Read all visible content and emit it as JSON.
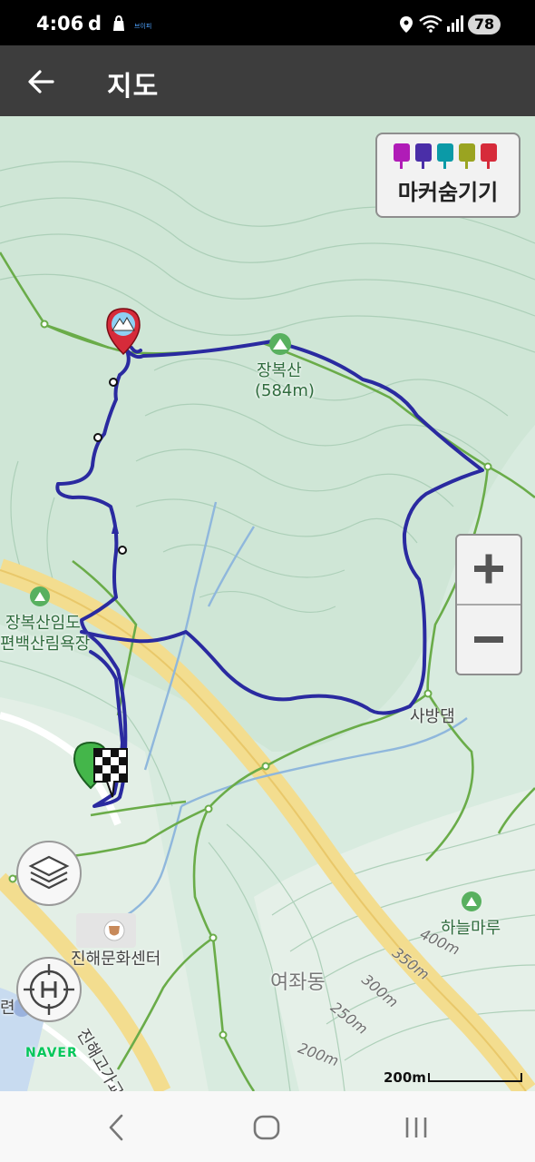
{
  "status": {
    "time": "4:06",
    "app_glyph": "d",
    "mini_text": "브이피",
    "battery": "78",
    "icons": [
      "shopping-bag-icon",
      "location-icon",
      "wifi-icon",
      "signal-icon"
    ]
  },
  "app_bar": {
    "title": "지도",
    "back_icon": "back-arrow-icon"
  },
  "map": {
    "marker_toggle_label": "마커숨기기",
    "marker_colors": [
      "#b01cb7",
      "#4a2ea8",
      "#0b9aa7",
      "#9aa421",
      "#d62b3a"
    ],
    "route_color": "#2a2aa0",
    "labels": {
      "peak_name": "장복산",
      "peak_elevation": "(584m)",
      "forest_line1": "장복산임도",
      "forest_line2": "편백산림욕장",
      "dam": "사방댐",
      "haneulmaru": "하늘마루",
      "culture_center": "진해문화센터",
      "district": "여좌동",
      "bridge": "진해고가교",
      "left_edge": "련"
    },
    "contours": [
      "400m",
      "350m",
      "300m",
      "250m",
      "200m"
    ],
    "zoom_in": "+",
    "zoom_out": "−",
    "logo": "NAVER",
    "scale": "200m"
  },
  "nav": {
    "back_icon": "nav-back-icon",
    "home_icon": "nav-home-icon",
    "recents_icon": "nav-recents-icon"
  }
}
